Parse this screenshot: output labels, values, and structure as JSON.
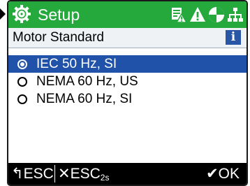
{
  "header": {
    "title": "Setup",
    "gear_icon": "gear-icon",
    "status_icons": [
      "document-warning-icon",
      "warning-icon",
      "hand-mode-icon",
      "network-tree-icon"
    ]
  },
  "subheader": {
    "title": "Motor Standard",
    "info_icon": "info-icon",
    "info_glyph": "i"
  },
  "options": [
    {
      "label": "IEC 50 Hz, SI",
      "selected": true
    },
    {
      "label": "NEMA 60 Hz, US",
      "selected": false
    },
    {
      "label": "NEMA 60 Hz, SI",
      "selected": false
    }
  ],
  "softkeys": {
    "back_label": "↰ESC",
    "escape_long_label": "✕ESC",
    "escape_long_suffix": "2s",
    "ok_label": "✔OK"
  },
  "colors": {
    "header_bg": "#25a93c",
    "selection_bg": "#1f52a8",
    "softkey_bg": "#000000",
    "info_bg": "#2a56a6"
  }
}
